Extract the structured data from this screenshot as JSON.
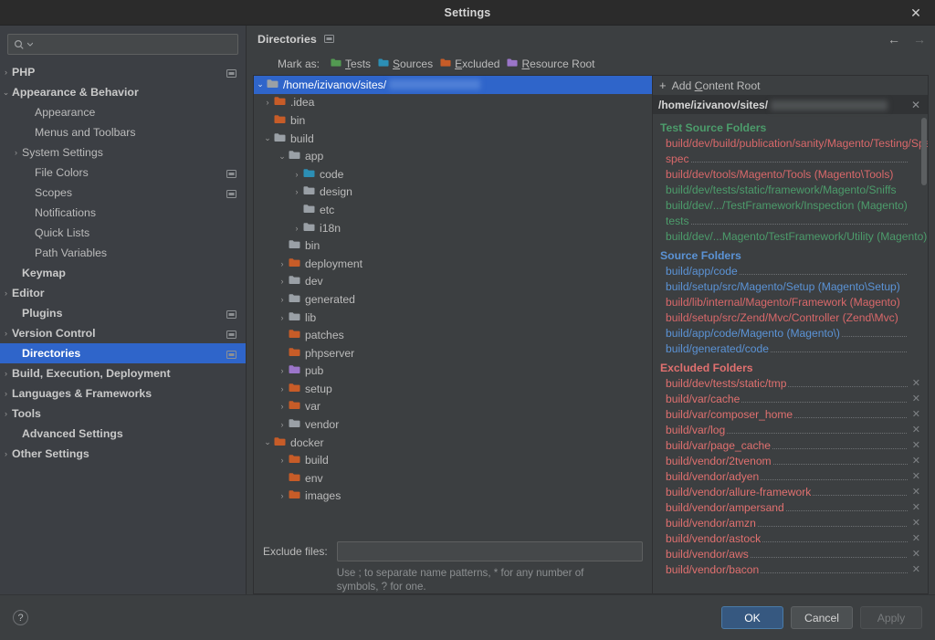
{
  "window": {
    "title": "Settings",
    "close_icon": "close-icon"
  },
  "search": {
    "value": "",
    "placeholder": "",
    "icon": "search-icon"
  },
  "sidebar": {
    "items": [
      {
        "label": "PHP",
        "arrow": "›",
        "bold": true,
        "indent": 8,
        "badge": true
      },
      {
        "label": "Appearance & Behavior",
        "arrow": "⌄",
        "bold": true,
        "indent": 8,
        "badge": false
      },
      {
        "label": "Appearance",
        "arrow": "",
        "bold": false,
        "indent": 38,
        "badge": false
      },
      {
        "label": "Menus and Toolbars",
        "arrow": "",
        "bold": false,
        "indent": 38,
        "badge": false
      },
      {
        "label": "System Settings",
        "arrow": "›",
        "bold": false,
        "indent": 24,
        "badge": false
      },
      {
        "label": "File Colors",
        "arrow": "",
        "bold": false,
        "indent": 38,
        "badge": true
      },
      {
        "label": "Scopes",
        "arrow": "",
        "bold": false,
        "indent": 38,
        "badge": true
      },
      {
        "label": "Notifications",
        "arrow": "",
        "bold": false,
        "indent": 38,
        "badge": false
      },
      {
        "label": "Quick Lists",
        "arrow": "",
        "bold": false,
        "indent": 38,
        "badge": false
      },
      {
        "label": "Path Variables",
        "arrow": "",
        "bold": false,
        "indent": 38,
        "badge": false
      },
      {
        "label": "Keymap",
        "arrow": "",
        "bold": true,
        "indent": 24,
        "badge": false
      },
      {
        "label": "Editor",
        "arrow": "›",
        "bold": true,
        "indent": 8,
        "badge": false
      },
      {
        "label": "Plugins",
        "arrow": "",
        "bold": true,
        "indent": 24,
        "badge": true
      },
      {
        "label": "Version Control",
        "arrow": "›",
        "bold": true,
        "indent": 8,
        "badge": true
      },
      {
        "label": "Directories",
        "arrow": "",
        "bold": true,
        "indent": 24,
        "badge": true,
        "selected": true
      },
      {
        "label": "Build, Execution, Deployment",
        "arrow": "›",
        "bold": true,
        "indent": 8,
        "badge": false
      },
      {
        "label": "Languages & Frameworks",
        "arrow": "›",
        "bold": true,
        "indent": 8,
        "badge": false
      },
      {
        "label": "Tools",
        "arrow": "›",
        "bold": true,
        "indent": 8,
        "badge": false
      },
      {
        "label": "Advanced Settings",
        "arrow": "",
        "bold": true,
        "indent": 24,
        "badge": false
      },
      {
        "label": "Other Settings",
        "arrow": "›",
        "bold": true,
        "indent": 8,
        "badge": false
      }
    ]
  },
  "content": {
    "title": "Directories",
    "back_arrow": "←",
    "forward_arrow": "→",
    "mark_as": {
      "label": "Mark as:",
      "options": [
        {
          "label": "Tests",
          "mnemonic": "T",
          "rest": "ests",
          "color": "#539a52"
        },
        {
          "label": "Sources",
          "mnemonic": "S",
          "rest": "ources",
          "color": "#2c8fb5"
        },
        {
          "label": "Excluded",
          "mnemonic": "E",
          "rest": "xcluded",
          "color": "#c75c28"
        },
        {
          "label": "Resource Root",
          "mnemonic": "R",
          "rest": "esource Root",
          "color": "#9b75c9"
        }
      ]
    }
  },
  "tree": {
    "rows": [
      {
        "label": "/home/izivanov/sites/",
        "twisty": "⌄",
        "indent": 6,
        "color": "gray",
        "selected": true,
        "blur_width": 100
      },
      {
        "label": ".idea",
        "twisty": "›",
        "indent": 22,
        "color": "orange"
      },
      {
        "label": "bin",
        "twisty": "",
        "indent": 22,
        "color": "orange"
      },
      {
        "label": "build",
        "twisty": "⌄",
        "indent": 22,
        "color": "gray"
      },
      {
        "label": "app",
        "twisty": "⌄",
        "indent": 38,
        "color": "gray"
      },
      {
        "label": "code",
        "twisty": "›",
        "indent": 54,
        "color": "blue"
      },
      {
        "label": "design",
        "twisty": "›",
        "indent": 54,
        "color": "gray"
      },
      {
        "label": "etc",
        "twisty": "",
        "indent": 54,
        "color": "gray"
      },
      {
        "label": "i18n",
        "twisty": "›",
        "indent": 54,
        "color": "gray"
      },
      {
        "label": "bin",
        "twisty": "",
        "indent": 38,
        "color": "gray"
      },
      {
        "label": "deployment",
        "twisty": "›",
        "indent": 38,
        "color": "orange"
      },
      {
        "label": "dev",
        "twisty": "›",
        "indent": 38,
        "color": "gray"
      },
      {
        "label": "generated",
        "twisty": "›",
        "indent": 38,
        "color": "gray"
      },
      {
        "label": "lib",
        "twisty": "›",
        "indent": 38,
        "color": "gray"
      },
      {
        "label": "patches",
        "twisty": "",
        "indent": 38,
        "color": "orange"
      },
      {
        "label": "phpserver",
        "twisty": "",
        "indent": 38,
        "color": "orange"
      },
      {
        "label": "pub",
        "twisty": "›",
        "indent": 38,
        "color": "purple"
      },
      {
        "label": "setup",
        "twisty": "›",
        "indent": 38,
        "color": "orange"
      },
      {
        "label": "var",
        "twisty": "›",
        "indent": 38,
        "color": "orange"
      },
      {
        "label": "vendor",
        "twisty": "›",
        "indent": 38,
        "color": "gray"
      },
      {
        "label": "docker",
        "twisty": "⌄",
        "indent": 22,
        "color": "orange"
      },
      {
        "label": "build",
        "twisty": "›",
        "indent": 38,
        "color": "orange"
      },
      {
        "label": "env",
        "twisty": "",
        "indent": 38,
        "color": "orange"
      },
      {
        "label": "images",
        "twisty": "›",
        "indent": 38,
        "color": "orange"
      }
    ],
    "exclude_files": {
      "label": "Exclude files:",
      "value": "",
      "placeholder": "",
      "hint": "Use ; to separate name patterns, * for any number of symbols, ? for one."
    }
  },
  "roots": {
    "add_button": {
      "plus": "+",
      "pre": "Add ",
      "mnemonic": "C",
      "rest": "ontent Root"
    },
    "path": "/home/izivanov/sites/",
    "path_close_icon": "close-icon",
    "groups": [
      {
        "title": "Test Source Folders",
        "title_color": "#4c9c6b",
        "entries": [
          {
            "text": "build/dev/build/publication/sanity/Magento/Testing/Spec",
            "color": "#d9686a",
            "dots": false
          },
          {
            "text": "spec",
            "color": "#d9686a",
            "dots": true
          },
          {
            "text": "build/dev/tools/Magento/Tools (Magento\\Tools)",
            "color": "#d9686a",
            "dots": false
          },
          {
            "text": "build/dev/tests/static/framework/Magento/Sniffs",
            "color": "#4c9c6b",
            "dots": false
          },
          {
            "text": "build/dev/.../TestFramework/Inspection (Magento)",
            "color": "#4c9c6b",
            "dots": false
          },
          {
            "text": "tests",
            "color": "#4c9c6b",
            "dots": true
          },
          {
            "text": "build/dev/...Magento/TestFramework/Utility (Magento)",
            "color": "#4c9c6b",
            "dots": false
          }
        ]
      },
      {
        "title": "Source Folders",
        "title_color": "#5b93d6",
        "entries": [
          {
            "text": "build/app/code",
            "color": "#5b93d6",
            "dots": true
          },
          {
            "text": "build/setup/src/Magento/Setup (Magento\\Setup)",
            "color": "#5b93d6",
            "dots": false
          },
          {
            "text": "build/lib/internal/Magento/Framework (Magento)",
            "color": "#d9686a",
            "dots": false
          },
          {
            "text": "build/setup/src/Zend/Mvc/Controller (Zend\\Mvc)",
            "color": "#d9686a",
            "dots": false
          },
          {
            "text": "build/app/code/Magento (Magento\\)",
            "color": "#5b93d6",
            "dots": true
          },
          {
            "text": "build/generated/code",
            "color": "#5b93d6",
            "dots": true
          }
        ]
      },
      {
        "title": "Excluded Folders",
        "title_color": "#e0706f",
        "entries": [
          {
            "text": "build/dev/tests/static/tmp",
            "color": "#e0706f",
            "dots": true,
            "remove": true
          },
          {
            "text": "build/var/cache",
            "color": "#e0706f",
            "dots": true,
            "remove": true
          },
          {
            "text": "build/var/composer_home",
            "color": "#e0706f",
            "dots": true,
            "remove": true
          },
          {
            "text": "build/var/log",
            "color": "#e0706f",
            "dots": true,
            "remove": true
          },
          {
            "text": "build/var/page_cache",
            "color": "#e0706f",
            "dots": true,
            "remove": true
          },
          {
            "text": "build/vendor/2tvenom",
            "color": "#e0706f",
            "dots": true,
            "remove": true
          },
          {
            "text": "build/vendor/adyen",
            "color": "#e0706f",
            "dots": true,
            "remove": true
          },
          {
            "text": "build/vendor/allure-framework",
            "color": "#e0706f",
            "dots": true,
            "remove": true
          },
          {
            "text": "build/vendor/ampersand",
            "color": "#e0706f",
            "dots": true,
            "remove": true
          },
          {
            "text": "build/vendor/amzn",
            "color": "#e0706f",
            "dots": true,
            "remove": true
          },
          {
            "text": "build/vendor/astock",
            "color": "#e0706f",
            "dots": true,
            "remove": true
          },
          {
            "text": "build/vendor/aws",
            "color": "#e0706f",
            "dots": true,
            "remove": true
          },
          {
            "text": "build/vendor/bacon",
            "color": "#e0706f",
            "dots": true,
            "remove": true
          }
        ]
      }
    ]
  },
  "footer": {
    "help": "?",
    "ok": "OK",
    "cancel": "Cancel",
    "apply": "Apply"
  }
}
